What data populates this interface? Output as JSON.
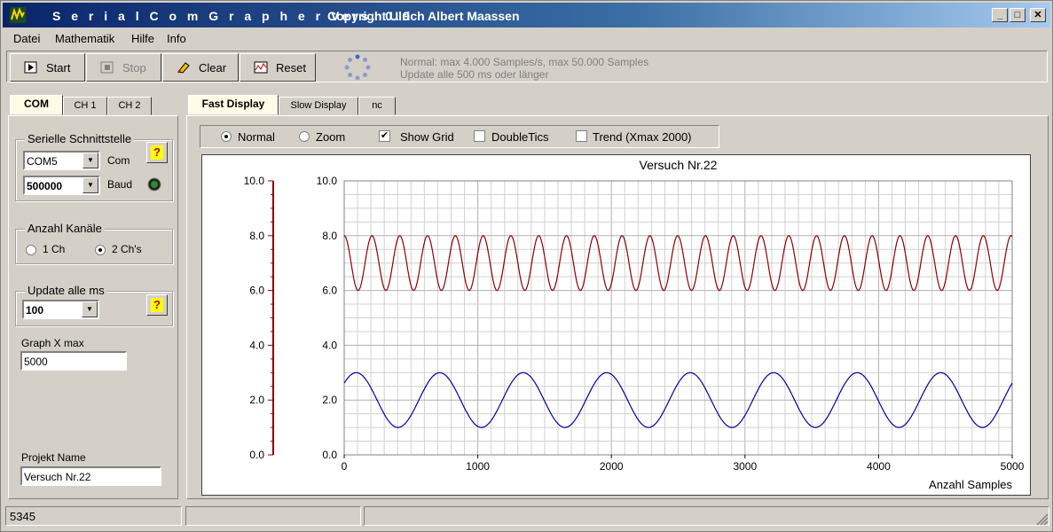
{
  "window": {
    "title": "S e r i a l C o m G r a p h e r   Vers. 0.9",
    "copyright": "Copyright Ulrich Albert Maassen",
    "controls": {
      "minimize": "_",
      "maximize": "□",
      "close": "✕"
    }
  },
  "menu": [
    "Datei",
    "Mathematik",
    "Hilfe",
    "Info"
  ],
  "toolbar": {
    "start": "Start",
    "stop": "Stop",
    "clear": "Clear",
    "reset": "Reset",
    "info_line1": "Normal: max 4.000 Samples/s, max 50.000 Samples",
    "info_line2": "Update alle 500 ms oder länger"
  },
  "left_tabs": [
    "COM",
    "CH 1",
    "CH 2"
  ],
  "left_panel": {
    "serial_group": "Serielle Schnittstelle",
    "port_value": "COM5",
    "port_label": "Com",
    "baud_value": "500000",
    "baud_label": "Baud",
    "help_glyph": "?",
    "channels_group": "Anzahl Kanäle",
    "ch1_label": "1 Ch",
    "ch2_label": "2 Ch's",
    "channels_selected": "2 Ch's",
    "update_group": "Update alle ms",
    "update_value": "100",
    "graph_xmax_label": "Graph X max",
    "graph_xmax_value": "5000",
    "project_label": "Projekt Name",
    "project_value": "Versuch Nr.22"
  },
  "display_tabs": [
    "Fast Display",
    "Slow Display",
    "nc"
  ],
  "display_options": {
    "normal": "Normal",
    "zoom": "Zoom",
    "show_grid": "Show Grid",
    "double_tics": "DoubleTics",
    "trend": "Trend (Xmax 2000)",
    "mode_selected": "Normal",
    "show_grid_checked": true,
    "double_tics_checked": false,
    "trend_checked": false
  },
  "chart_data": {
    "type": "line",
    "title": "Versuch Nr.22",
    "xlabel": "Anzahl Samples",
    "ylabel": "",
    "xlim": [
      0,
      5000
    ],
    "ylim": [
      0,
      10
    ],
    "x_ticks": [
      "0",
      "1000",
      "2000",
      "3000",
      "4000",
      "5000"
    ],
    "y_ticks": [
      "0.0",
      "2.0",
      "4.0",
      "6.0",
      "8.0",
      "10.0"
    ],
    "grid": true,
    "series": [
      {
        "color": "#8b0000",
        "offset": 7.0,
        "amplitude": 1.0,
        "period": 208,
        "phase_x": 0
      },
      {
        "color": "#0000a0",
        "offset": 2.0,
        "amplitude": 1.0,
        "period": 625,
        "phase_x": 90
      }
    ],
    "left_axis_color": "#8b0000"
  },
  "status": {
    "count": "5345"
  }
}
